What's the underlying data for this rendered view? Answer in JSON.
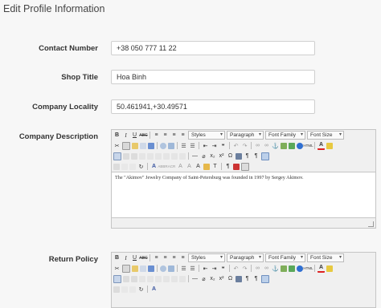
{
  "page": {
    "title": "Edit Profile Information"
  },
  "form": {
    "contact_number": {
      "label": "Contact Number",
      "value": "+38 050 777 11 22"
    },
    "shop_title": {
      "label": "Shop Title",
      "value": "Hoa Binh"
    },
    "company_locality": {
      "label": "Company Locality",
      "value": "50.461941,+30.49571"
    },
    "company_description": {
      "label": "Company Description",
      "content": "The \"Akimov\" Jewelry Company of Saint-Petersburg was founded in 1997 by Sergey Akimov."
    },
    "return_policy": {
      "label": "Return Policy",
      "content": ""
    }
  },
  "editor": {
    "dropdowns": {
      "styles": "Styles",
      "format": "Paragraph",
      "font_family": "Font Family",
      "font_size": "Font Size"
    }
  }
}
